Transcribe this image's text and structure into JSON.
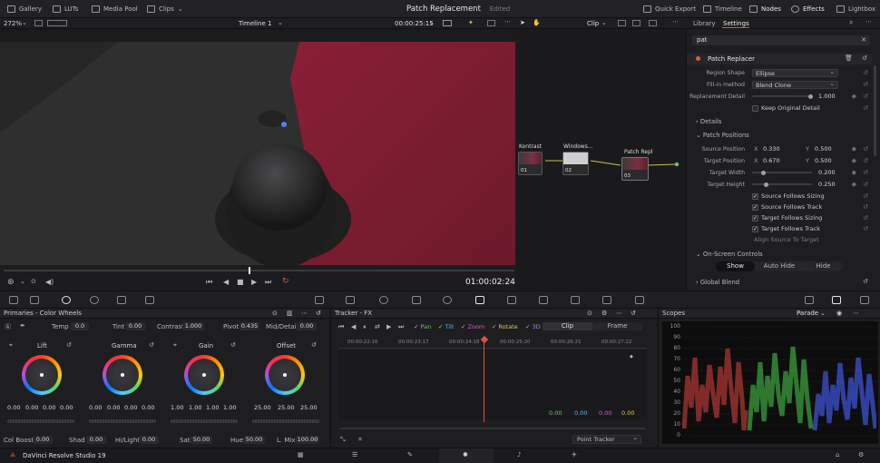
{
  "topbar": {
    "gallery": "Gallery",
    "luts": "LUTs",
    "media_pool": "Media Pool",
    "clips": "Clips",
    "title": "Patch Replacement",
    "status": "Edited",
    "quick_export": "Quick Export",
    "timeline": "Timeline",
    "nodes": "Nodes",
    "effects": "Effects",
    "lightbox": "Lightbox"
  },
  "viewer": {
    "zoom": "272%",
    "timeline_name": "Timeline 1",
    "timecode_top": "00:00:25:15",
    "timecode": "01:00:02:24",
    "scrub_position": 0.48
  },
  "node_editor": {
    "mode": "Clip",
    "nodes": [
      {
        "label": "Kontrast",
        "num": "01"
      },
      {
        "label": "Windows...",
        "num": "02"
      },
      {
        "label": "Patch Repl",
        "num": "03"
      }
    ]
  },
  "inspector": {
    "tab_library": "Library",
    "tab_settings": "Settings",
    "search": "pat",
    "effect_name": "Patch Replacer",
    "region_shape_label": "Region Shape",
    "region_shape": "Ellipse",
    "fill_method_label": "Fill-in method",
    "fill_method": "Blend Clone",
    "replacement_detail_label": "Replacement Detail",
    "replacement_detail": "1.000",
    "keep_original_label": "Keep Original Detail",
    "details": "Details",
    "patch_positions": "Patch Positions",
    "source_position_label": "Source Position",
    "source_x": "0.330",
    "source_y": "0.500",
    "target_position_label": "Target Position",
    "target_x": "0.670",
    "target_y": "0.500",
    "x_label": "X",
    "y_label": "Y",
    "target_width_label": "Target Width",
    "target_width": "0.200",
    "target_height_label": "Target Height",
    "target_height": "0.250",
    "source_follows_sizing": "Source Follows Sizing",
    "source_follows_track": "Source Follows Track",
    "target_follows_sizing": "Target Follows Sizing",
    "target_follows_track": "Target Follows Track",
    "align_source": "Align Source To Target",
    "on_screen_controls": "On-Screen Controls",
    "show": "Show",
    "auto_hide": "Auto Hide",
    "hide": "Hide",
    "global_blend": "Global Blend"
  },
  "primaries": {
    "title": "Primaries - Color Wheels",
    "temp_label": "Temp",
    "temp": "0.0",
    "tint_label": "Tint",
    "tint": "0.00",
    "contrast_label": "Contrast",
    "contrast": "1.000",
    "pivot_label": "Pivot",
    "pivot": "0.435",
    "middetail_label": "Mid/Detail",
    "middetail": "0.00",
    "wheels": [
      {
        "name": "Lift",
        "values": [
          "0.00",
          "0.00",
          "0.00",
          "0.00"
        ]
      },
      {
        "name": "Gamma",
        "values": [
          "0.00",
          "0.00",
          "0.00",
          "0.00"
        ]
      },
      {
        "name": "Gain",
        "values": [
          "1.00",
          "1.00",
          "1.00",
          "1.00"
        ]
      },
      {
        "name": "Offset",
        "values": [
          "25.00",
          "25.00",
          "25.00"
        ]
      }
    ],
    "colboost_label": "Col Boost",
    "colboost": "0.00",
    "shad_label": "Shad",
    "shad": "0.00",
    "hilight_label": "Hi/Light",
    "hilight": "0.00",
    "sat_label": "Sat",
    "sat": "50.00",
    "hue_label": "Hue",
    "hue": "50.00",
    "lmix_label": "L. Mix",
    "lmix": "100.00"
  },
  "tracker": {
    "title": "Tracker - FX",
    "pan": "Pan",
    "tilt": "Tilt",
    "zoom": "Zoom",
    "rotate": "Rotate",
    "three_d": "3D",
    "clip": "Clip",
    "frame": "Frame",
    "ticks": [
      "00:00:22:16",
      "00:00:23:17",
      "00:00:24:18",
      "00:00:25:20",
      "00:00:26:21",
      "00:00:27:22"
    ],
    "readouts": [
      "0.00",
      "0.00",
      "0.00",
      "0.00"
    ],
    "mode": "Point Tracker"
  },
  "scopes": {
    "title": "Scopes",
    "mode": "Parade",
    "scale": [
      "100",
      "90",
      "80",
      "70",
      "60",
      "50",
      "40",
      "30",
      "20",
      "10",
      "0"
    ]
  },
  "bottom": {
    "app_name": "DaVinci Resolve Studio 19"
  },
  "colors": {
    "accent": "#e05a47",
    "clip_blue": "#6f7cff",
    "playhead": "#e0503c"
  }
}
